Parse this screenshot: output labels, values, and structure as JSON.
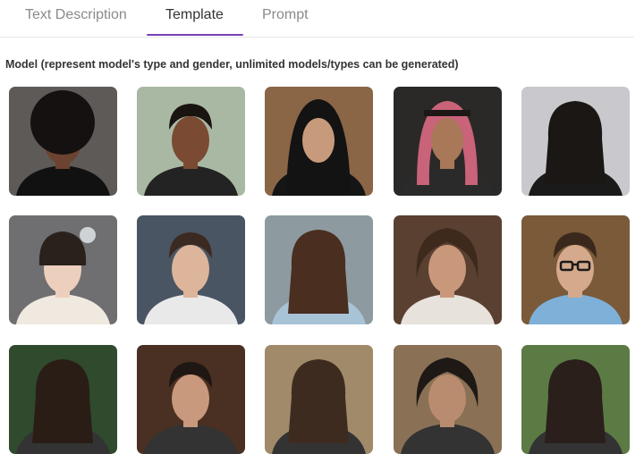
{
  "tabs": [
    {
      "label": "Text Description",
      "active": false
    },
    {
      "label": "Template",
      "active": true
    },
    {
      "label": "Prompt",
      "active": false
    }
  ],
  "accent_color": "#7b3fb8",
  "section": {
    "heading": "Model (represent model's type and gender, unlimited models/types can be generated)"
  },
  "models": [
    {
      "bg": "#5e5a58",
      "skin": "#6b4330",
      "hair": "#151110",
      "cloth": "#111111",
      "style": "afro"
    },
    {
      "bg": "#a9b8a3",
      "skin": "#7a4a33",
      "hair": "#1a1411",
      "cloth": "#232323",
      "style": "short"
    },
    {
      "bg": "#8a6546",
      "skin": "#c89a7c",
      "hair": "#131313",
      "cloth": "#151515",
      "style": "hijab"
    },
    {
      "bg": "#2b2928",
      "skin": "#a97858",
      "hair": "#1d1816",
      "cloth": "#2a2a2a",
      "style": "keffiyeh"
    },
    {
      "bg": "#c9c9cd",
      "skin": "#e6c6b0",
      "hair": "#1b1715",
      "cloth": "#1a1a1a",
      "style": "long"
    },
    {
      "bg": "#6f6e70",
      "skin": "#edcfbe",
      "hair": "#2a211d",
      "cloth": "#efe9df",
      "style": "bun"
    },
    {
      "bg": "#4a5563",
      "skin": "#dcb59b",
      "hair": "#3b2a22",
      "cloth": "#e9e9ea",
      "style": "short"
    },
    {
      "bg": "#8d9aa0",
      "skin": "#d8ab8d",
      "hair": "#4a2e1f",
      "cloth": "#a9c3d6",
      "style": "long"
    },
    {
      "bg": "#5a4030",
      "skin": "#c9987a",
      "hair": "#3e2a1d",
      "cloth": "#e7e2dc",
      "style": "curly"
    },
    {
      "bg": "#7a5a38",
      "skin": "#d4a98c",
      "hair": "#3a281d",
      "cloth": "#7fb0d8",
      "style": "glasses"
    },
    {
      "bg": "#2f4a2c",
      "skin": "#c69a7d",
      "hair": "#2a1d16",
      "cloth": "#333333",
      "style": "long"
    },
    {
      "bg": "#4a3022",
      "skin": "#c8997c",
      "hair": "#1e1714",
      "cloth": "#333333",
      "style": "short"
    },
    {
      "bg": "#a08a6a",
      "skin": "#d3a98c",
      "hair": "#3e2b20",
      "cloth": "#333333",
      "style": "long"
    },
    {
      "bg": "#8a7055",
      "skin": "#b98c70",
      "hair": "#1f1916",
      "cloth": "#333333",
      "style": "curly"
    },
    {
      "bg": "#5b7a44",
      "skin": "#d8b39a",
      "hair": "#2a1f1a",
      "cloth": "#333333",
      "style": "long"
    }
  ]
}
